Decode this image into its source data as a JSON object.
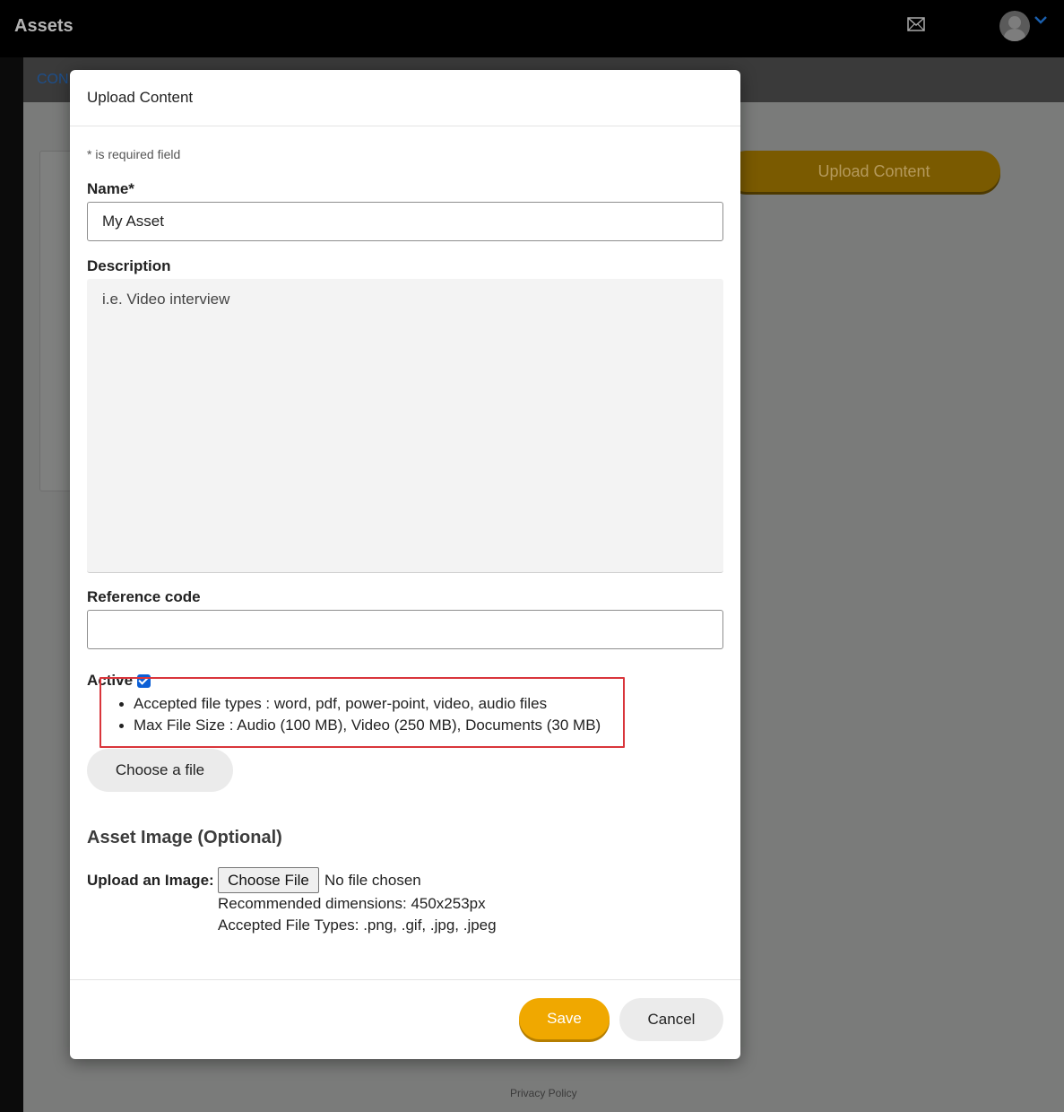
{
  "app": {
    "title": "Assets",
    "icons": {
      "mail": "mail-icon",
      "avatar": "avatar-icon",
      "menu": "chevron-down-icon"
    },
    "subnav_tab": "CON",
    "background_button": "Upload Content",
    "footer_link": "Privacy Policy"
  },
  "modal": {
    "title": "Upload Content",
    "required_note": "* is required field",
    "name": {
      "label": "Name*",
      "value": "My Asset"
    },
    "description": {
      "label": "Description",
      "placeholder": "i.e. Video interview",
      "value": ""
    },
    "reference_code": {
      "label": "Reference code",
      "value": ""
    },
    "active": {
      "label": "Active",
      "checked": true
    },
    "info": [
      "Accepted file types : word, pdf, power-point, video, audio files",
      "Max File Size : Audio (100 MB), Video (250 MB), Documents (30 MB)"
    ],
    "choose_file_label": "Choose a file",
    "asset_image": {
      "title": "Asset Image (Optional)",
      "upload_label": "Upload an Image:",
      "file_button": "Choose File",
      "file_status": "No file chosen",
      "hint_dimensions": "Recommended dimensions: 450x253px",
      "hint_types": "Accepted File Types: .png, .gif, .jpg, .jpeg"
    },
    "save_label": "Save",
    "cancel_label": "Cancel"
  },
  "colors": {
    "accent": "#f0a800",
    "checkbox": "#0b5fd6",
    "highlight_border": "#d9353b"
  }
}
